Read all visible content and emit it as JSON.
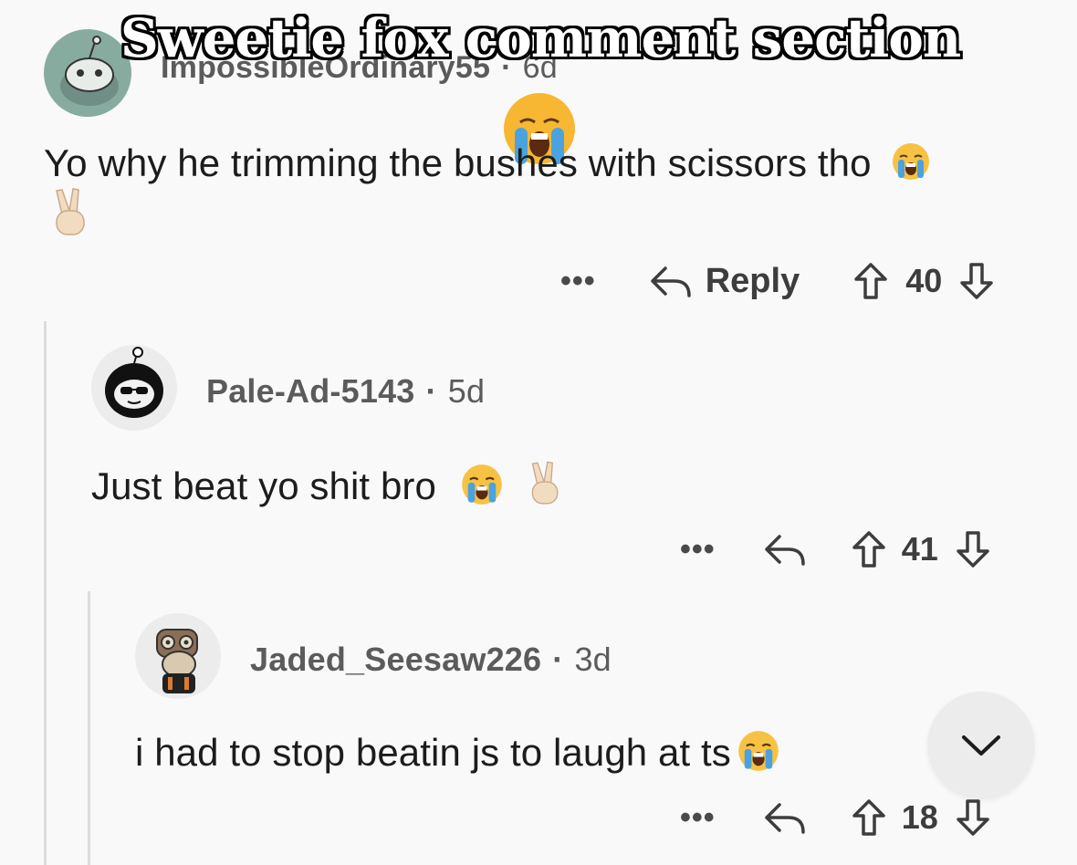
{
  "overlay": {
    "title": "Sweetie fox comment section"
  },
  "colors": {
    "background": "#f9f9f9",
    "text": "#1c1c1c",
    "meta": "#5b5b5b",
    "thread_line": "#dcdcdc"
  },
  "comments": [
    {
      "username": "ImpossibleOrdinary55",
      "separator": "·",
      "age": "6d",
      "text": "Yo why he trimming the bushes with scissors tho",
      "emojis": [
        "loudly-crying-face",
        "victory-hand"
      ],
      "reply_label": "Reply",
      "more": "•••",
      "votes": "40"
    },
    {
      "username": "Pale-Ad-5143",
      "separator": "·",
      "age": "5d",
      "text": "Just beat yo shit bro",
      "emojis": [
        "loudly-crying-face",
        "victory-hand"
      ],
      "more": "•••",
      "votes": "41"
    },
    {
      "username": "Jaded_Seesaw226",
      "separator": "·",
      "age": "3d",
      "text": "i had to stop beatin js to laugh at ts",
      "emojis": [
        "loudly-crying-face"
      ],
      "more": "•••",
      "votes": "18"
    }
  ],
  "icons": {
    "reply": "reply-arrow-icon",
    "upvote": "upvote-arrow-icon",
    "downvote": "downvote-arrow-icon",
    "scroll": "chevron-down-icon"
  }
}
